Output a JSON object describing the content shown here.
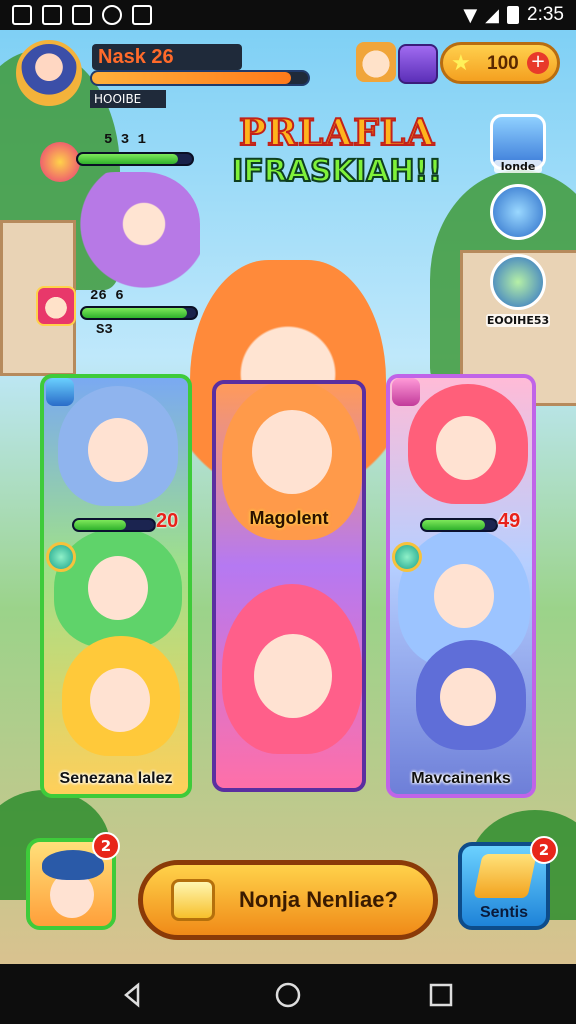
{
  "status_bar": {
    "time": "2:35"
  },
  "player": {
    "name": "Nask 26",
    "title": "HOOIBE",
    "xp_progress": 0.92
  },
  "currency": {
    "coins": "100"
  },
  "logo": {
    "line1": "PRLAFLA",
    "line2": "IFRASKIAH!!"
  },
  "side_menu": {
    "items": [
      {
        "label": "Ionde",
        "icon": "castle-icon"
      },
      {
        "label": "",
        "icon": "compass-icon"
      },
      {
        "label": "EOOIHE53",
        "icon": "ticket-icon"
      }
    ]
  },
  "left_hud": {
    "top_stat": "5 3 1",
    "top_hp": 0.88,
    "second_stats": "26 6",
    "third_stat": "S3",
    "second_hp": 0.92
  },
  "cards": {
    "left": {
      "name": "Senezana lalez",
      "value": "20",
      "hp": 0.65
    },
    "center": {
      "name": "Magolent"
    },
    "right": {
      "name": "Mavcainenks",
      "value": "49",
      "hp": 0.85
    }
  },
  "bottom_bar": {
    "hero_badge": "2",
    "play_label": "Nonja Nenliae?",
    "shop_label": "Sentis",
    "shop_badge": "2"
  },
  "colors": {
    "accent_orange": "#f4a020",
    "hp_green": "#2fb12c",
    "card_green": "#3ecb3a",
    "card_purple": "#c064e8"
  }
}
